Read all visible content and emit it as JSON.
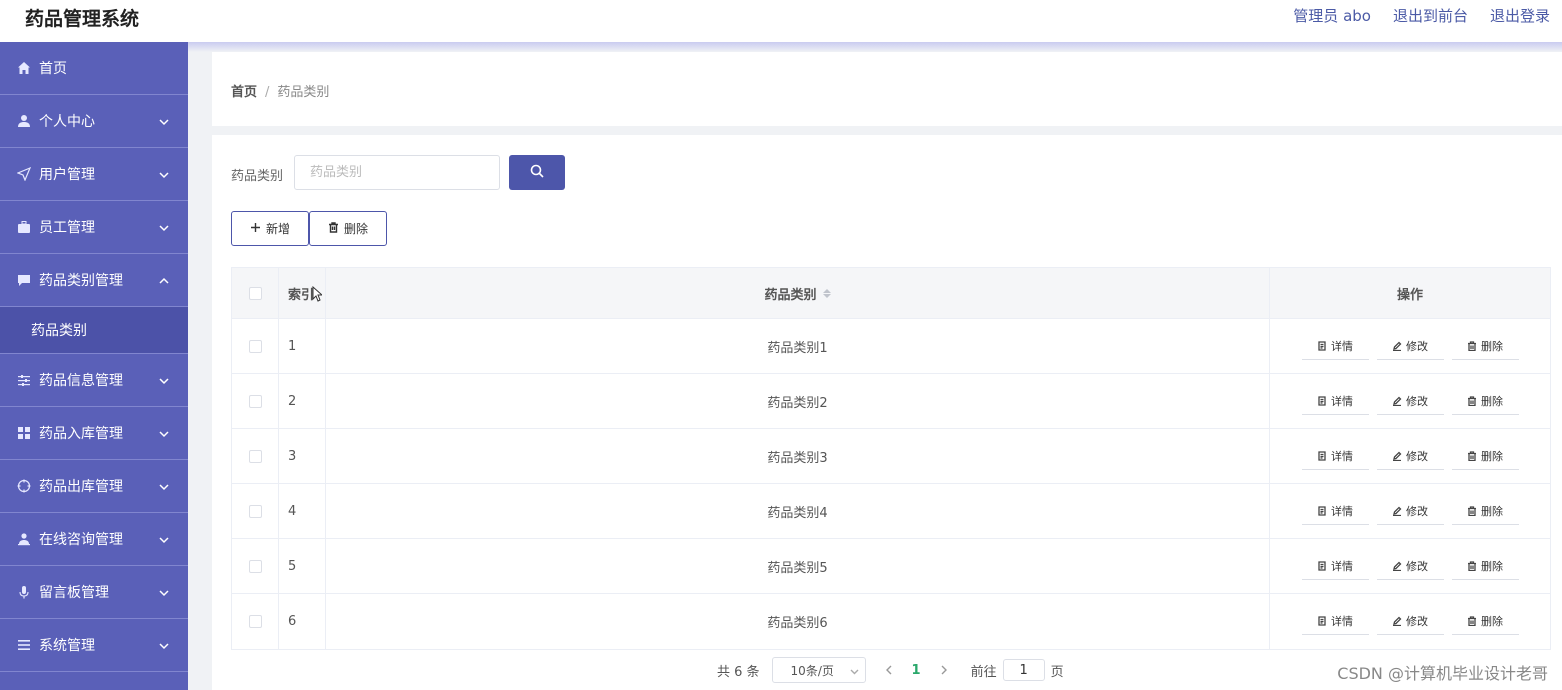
{
  "header": {
    "title": "药品管理系统",
    "admin_label": "管理员 abo",
    "front_link": "退出到前台",
    "logout_link": "退出登录"
  },
  "sidebar": {
    "items": [
      {
        "label": "首页",
        "icon": "home-icon"
      },
      {
        "label": "个人中心",
        "icon": "user-icon"
      },
      {
        "label": "用户管理",
        "icon": "send-icon"
      },
      {
        "label": "员工管理",
        "icon": "briefcase-icon"
      },
      {
        "label": "药品类别管理",
        "icon": "chat-icon"
      },
      {
        "label": "药品信息管理",
        "icon": "sliders-icon"
      },
      {
        "label": "药品入库管理",
        "icon": "grid-icon"
      },
      {
        "label": "药品出库管理",
        "icon": "crosshair-icon"
      },
      {
        "label": "在线咨询管理",
        "icon": "person-icon"
      },
      {
        "label": "留言板管理",
        "icon": "mic-icon"
      },
      {
        "label": "系统管理",
        "icon": "menu-icon"
      }
    ],
    "sub_item": "药品类别"
  },
  "breadcrumb": {
    "home": "首页",
    "separator": "/",
    "current": "药品类别"
  },
  "search": {
    "label": "药品类别",
    "placeholder": "药品类别"
  },
  "toolbar": {
    "add_label": "新增",
    "delete_label": "删除"
  },
  "table": {
    "headers": {
      "index": "索引",
      "name": "药品类别",
      "ops": "操作"
    },
    "rows": [
      {
        "index": "1",
        "name": "药品类别1"
      },
      {
        "index": "2",
        "name": "药品类别2"
      },
      {
        "index": "3",
        "name": "药品类别3"
      },
      {
        "index": "4",
        "name": "药品类别4"
      },
      {
        "index": "5",
        "name": "药品类别5"
      },
      {
        "index": "6",
        "name": "药品类别6"
      }
    ],
    "ops": {
      "detail": "详情",
      "edit": "修改",
      "delete": "删除"
    }
  },
  "pagination": {
    "total": "共 6 条",
    "page_size": "10条/页",
    "current_page": "1",
    "goto_label": "前往",
    "goto_value": "1",
    "page_unit": "页"
  },
  "watermark": "CSDN @计算机毕业设计老哥"
}
